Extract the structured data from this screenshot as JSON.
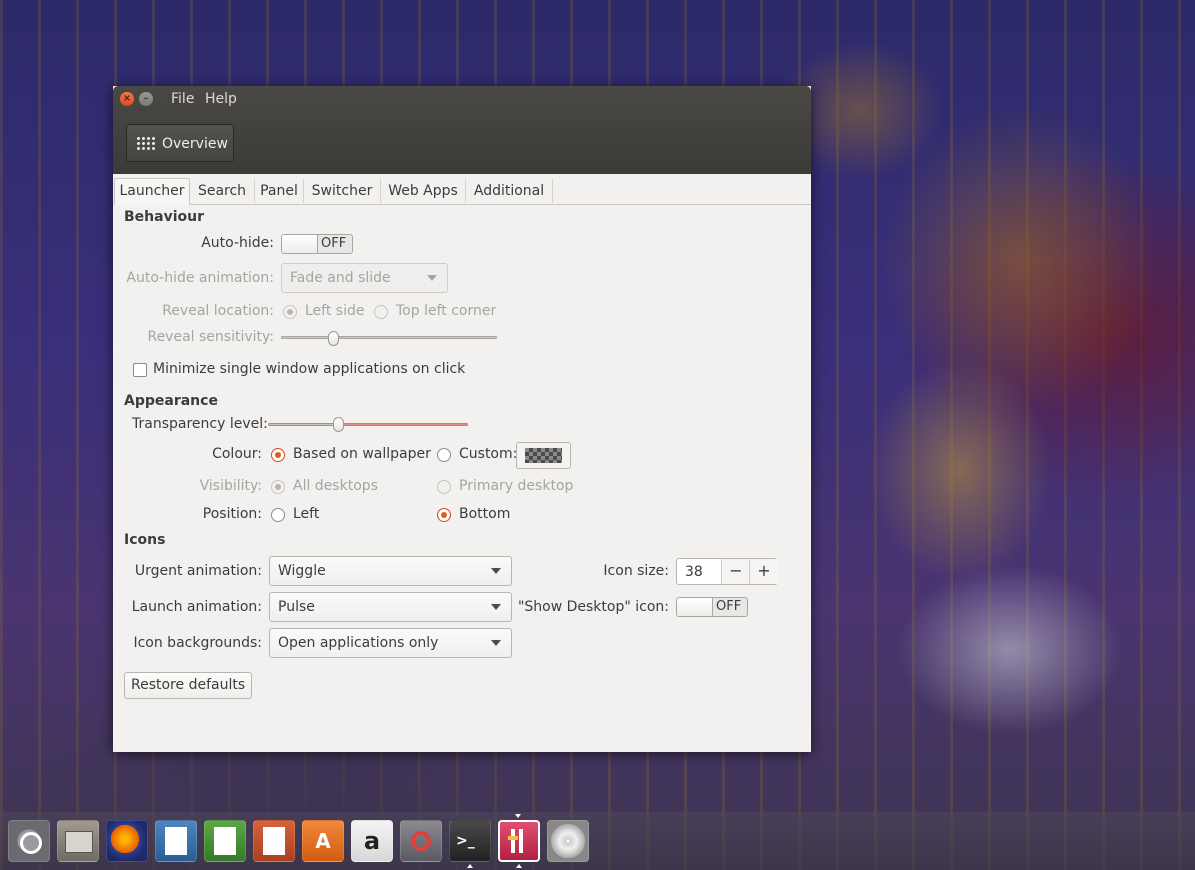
{
  "window": {
    "menu": {
      "file": "File",
      "help": "Help"
    },
    "toolbar": {
      "overview": "Overview"
    }
  },
  "tabs": [
    "Launcher",
    "Search",
    "Panel",
    "Switcher",
    "Web Apps",
    "Additional"
  ],
  "behaviour": {
    "heading": "Behaviour",
    "autohide_label": "Auto-hide:",
    "autohide_state": "OFF",
    "autohide_animation_label": "Auto-hide animation:",
    "autohide_animation_value": "Fade and slide",
    "reveal_location_label": "Reveal location:",
    "reveal_left": "Left side",
    "reveal_topleft": "Top left corner",
    "reveal_sensitivity_label": "Reveal sensitivity:",
    "reveal_sensitivity_level": 0.24,
    "minimize_label": "Minimize single window applications on click"
  },
  "appearance": {
    "heading": "Appearance",
    "transparency_label": "Transparency level:",
    "transparency_level": 0.35,
    "colour_label": "Colour:",
    "colour_wallpaper": "Based on wallpaper",
    "colour_custom": "Custom:",
    "visibility_label": "Visibility:",
    "visibility_all": "All desktops",
    "visibility_primary": "Primary desktop",
    "position_label": "Position:",
    "position_left": "Left",
    "position_bottom": "Bottom"
  },
  "icons": {
    "heading": "Icons",
    "urgent_label": "Urgent animation:",
    "urgent_value": "Wiggle",
    "launch_label": "Launch animation:",
    "launch_value": "Pulse",
    "backgrounds_label": "Icon backgrounds:",
    "backgrounds_value": "Open applications only",
    "icon_size_label": "Icon size:",
    "icon_size_value": "38",
    "minus": "−",
    "plus": "+",
    "show_desktop_label": "\"Show Desktop\" icon:",
    "show_desktop_state": "OFF"
  },
  "restore": "Restore defaults",
  "dock": {
    "items": [
      "ubuntu-icon",
      "files-icon",
      "firefox-icon",
      "writer-icon",
      "calc-icon",
      "impress-icon",
      "software-center-icon",
      "amazon-icon",
      "system-settings-icon",
      "terminal-icon",
      "unity-tweak-icon",
      "disc-icon"
    ],
    "amazon_glyph": "a",
    "terminal_glyph": ">_",
    "software_glyph": "A"
  },
  "colors": {
    "accent": "#e05a1e",
    "titlebar": "#3c3b37"
  }
}
